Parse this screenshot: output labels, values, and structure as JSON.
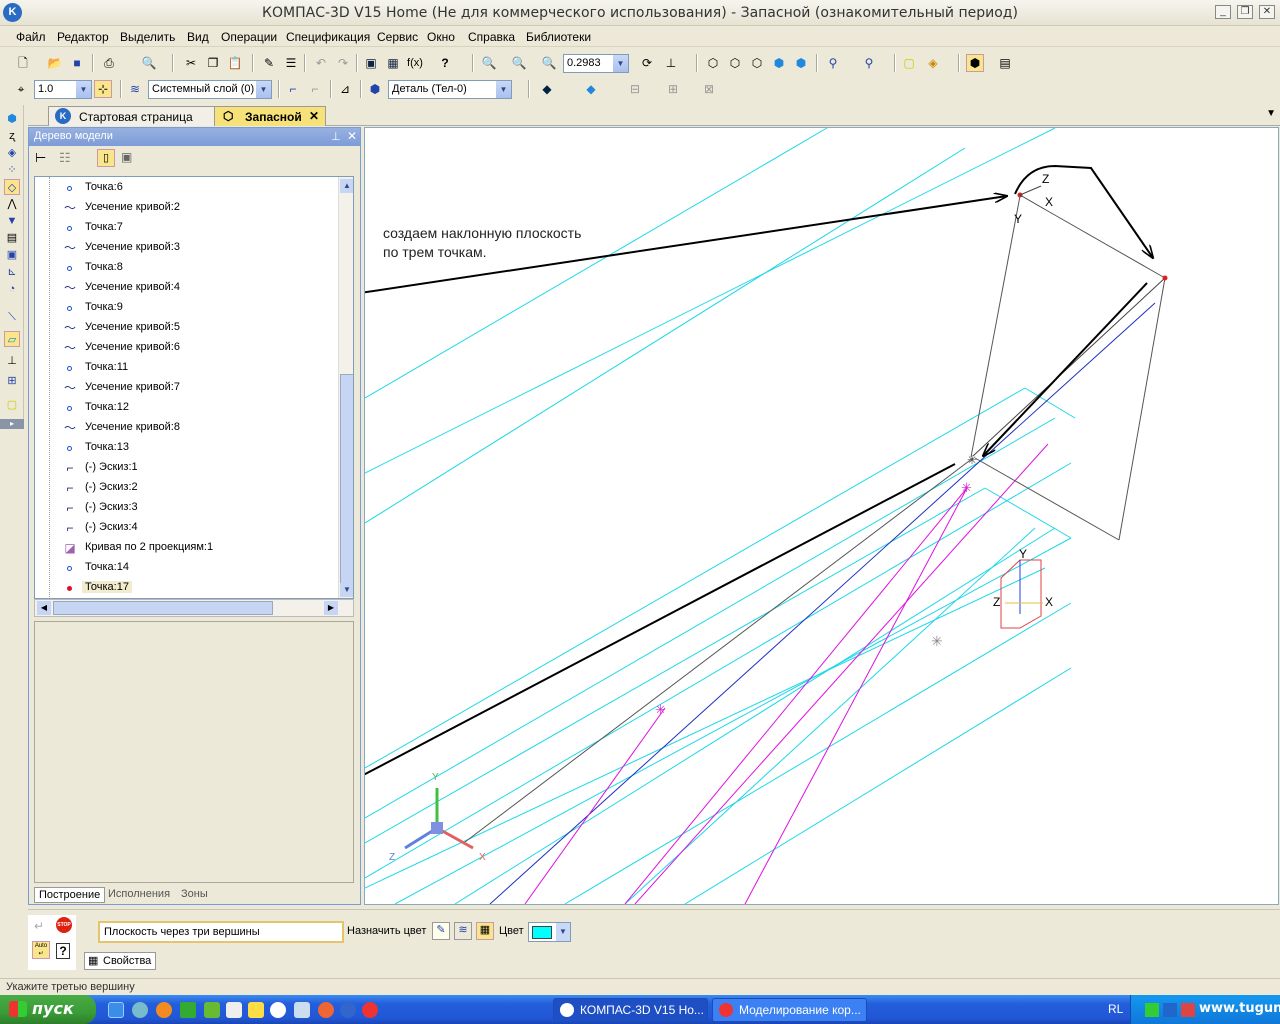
{
  "window": {
    "title": "КОМПАС-3D V15 Home (Не для коммерческого использования) - Запасной (ознакомительный период)"
  },
  "menu": [
    "Файл",
    "Редактор",
    "Выделить",
    "Вид",
    "Операции",
    "Спецификация",
    "Сервис",
    "Окно",
    "Справка",
    "Библиотеки"
  ],
  "toolbar": {
    "zoom_value": "0.2983",
    "step_value": "1.0",
    "layer_value": "Системный слой (0)",
    "detail_value": "Деталь (Тел-0)"
  },
  "tabs": [
    {
      "label": "Стартовая страница"
    },
    {
      "label": "Запасной"
    }
  ],
  "tree": {
    "title": "Дерево модели",
    "items": [
      {
        "label": "Точка:6",
        "type": "point"
      },
      {
        "label": "Усечение кривой:2",
        "type": "trim"
      },
      {
        "label": "Точка:7",
        "type": "point"
      },
      {
        "label": "Усечение кривой:3",
        "type": "trim"
      },
      {
        "label": "Точка:8",
        "type": "point"
      },
      {
        "label": "Усечение кривой:4",
        "type": "trim"
      },
      {
        "label": "Точка:9",
        "type": "point"
      },
      {
        "label": "Усечение кривой:5",
        "type": "trim"
      },
      {
        "label": "Усечение кривой:6",
        "type": "trim"
      },
      {
        "label": "Точка:11",
        "type": "point"
      },
      {
        "label": "Усечение кривой:7",
        "type": "trim"
      },
      {
        "label": "Точка:12",
        "type": "point"
      },
      {
        "label": "Усечение кривой:8",
        "type": "trim"
      },
      {
        "label": "Точка:13",
        "type": "point"
      },
      {
        "label": "(-) Эскиз:1",
        "type": "sketch"
      },
      {
        "label": "(-) Эскиз:2",
        "type": "sketch"
      },
      {
        "label": "(-) Эскиз:3",
        "type": "sketch"
      },
      {
        "label": "(-) Эскиз:4",
        "type": "sketch"
      },
      {
        "label": "Кривая по 2 проекциям:1",
        "type": "curve"
      },
      {
        "label": "Точка:14",
        "type": "point"
      },
      {
        "label": "Точка:17",
        "type": "point-active"
      }
    ],
    "bottom_tabs": [
      "Построение",
      "Исполнения",
      "Зоны"
    ]
  },
  "viewport": {
    "annotation_line1": "создаем наклонную плоскость",
    "annotation_line2": "по трем точкам.",
    "axis_labels": {
      "x": "X",
      "y": "Y",
      "z": "Z"
    }
  },
  "properties": {
    "command_field": "Плоскость через три вершины",
    "assign_color_label": "Назначить цвет",
    "color_label": "Цвет",
    "color_value": "#00ffff",
    "properties_tab": "Свойства"
  },
  "status": {
    "text": "Укажите третью вершину"
  },
  "taskbar": {
    "start_label": "пуск",
    "tasks": [
      "КОМПАС-3D V15 Ho...",
      "Моделирование кор..."
    ],
    "lang": "RL",
    "watermark": "www.tugun.ru"
  }
}
